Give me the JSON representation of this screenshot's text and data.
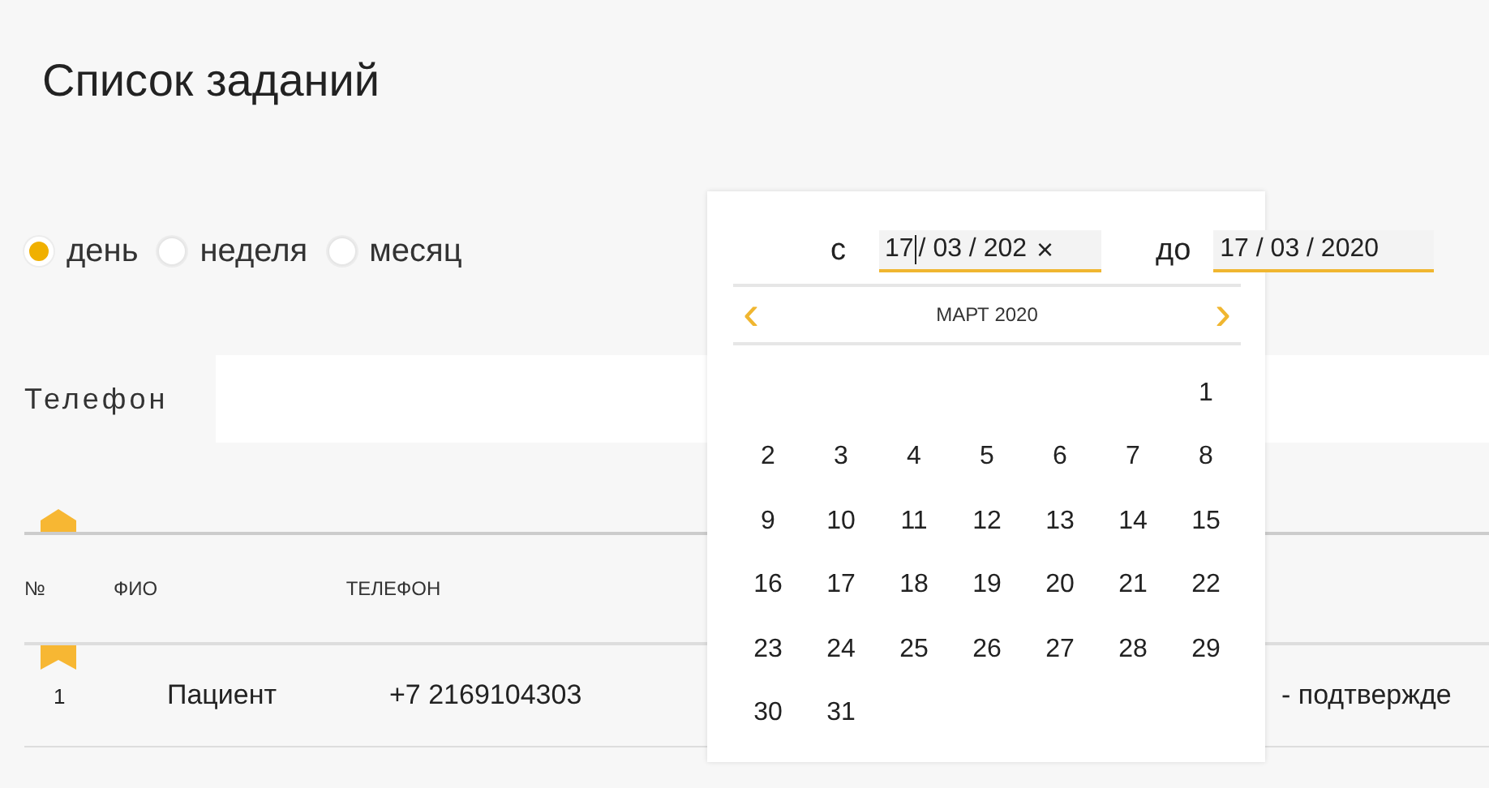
{
  "title": "Список заданий",
  "periods": [
    {
      "label": "день",
      "selected": true
    },
    {
      "label": "неделя",
      "selected": false
    },
    {
      "label": "месяц",
      "selected": false
    }
  ],
  "date_range": {
    "from_label": "с",
    "from_value": "17",
    "from_rest": "/ 03 / 202",
    "clear": "×",
    "to_label": "до",
    "to_value": "17 / 03 / 2020"
  },
  "phone_filter": {
    "label": "Телефон"
  },
  "calendar": {
    "prev": "‹",
    "month": "МАРТ 2020",
    "next": "›",
    "weeks": [
      {
        "kind": "first",
        "days": [
          "1"
        ]
      },
      {
        "kind": "full",
        "days": [
          "2",
          "3",
          "4",
          "5",
          "6",
          "7",
          "8"
        ]
      },
      {
        "kind": "full",
        "days": [
          "9",
          "10",
          "11",
          "12",
          "13",
          "14",
          "15"
        ]
      },
      {
        "kind": "full",
        "days": [
          "16",
          "17",
          "18",
          "19",
          "20",
          "21",
          "22"
        ]
      },
      {
        "kind": "full",
        "days": [
          "23",
          "24",
          "25",
          "26",
          "27",
          "28",
          "29"
        ]
      },
      {
        "kind": "last",
        "days": [
          "30",
          "31"
        ]
      }
    ]
  },
  "table": {
    "columns": [
      "№",
      "ФИО",
      "ТЕЛЕФОН"
    ],
    "rows": [
      {
        "number": "1",
        "name": "Пациент",
        "phone": "+7 2169104303",
        "status": "- подтвержде"
      }
    ]
  }
}
